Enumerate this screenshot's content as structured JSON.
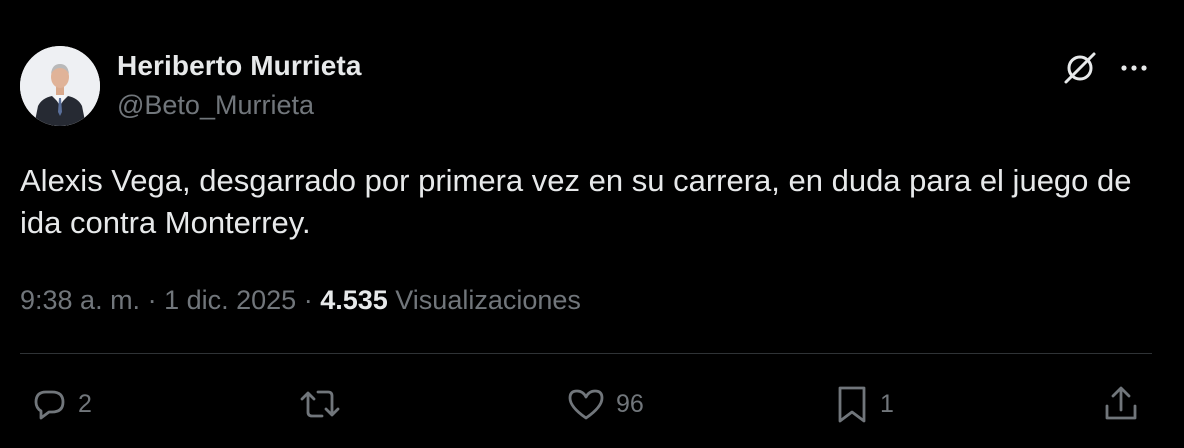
{
  "author": {
    "name": "Heriberto Murrieta",
    "handle": "@Beto_Murrieta"
  },
  "tweet": {
    "text": "Alexis Vega, desgarrado por primera vez en su carrera, en duda para el juego de ida contra Monterrey.",
    "time": "9:38 a. m.",
    "separator1": " · ",
    "date": "1 dic. 2025",
    "separator2": " · ",
    "views_count": "4.535",
    "views_label": "Visualizaciones"
  },
  "actions": {
    "replies": "2",
    "retweets": "",
    "likes": "96",
    "bookmarks": "1"
  },
  "icons": {
    "grok": "grok-icon",
    "more": "more-icon",
    "reply": "reply-icon",
    "retweet": "retweet-icon",
    "like": "heart-icon",
    "bookmark": "bookmark-icon",
    "share": "share-icon"
  },
  "colors": {
    "background": "#000000",
    "primary_text": "#e7e9ea",
    "secondary_text": "#71767b",
    "divider": "#2f3336"
  }
}
